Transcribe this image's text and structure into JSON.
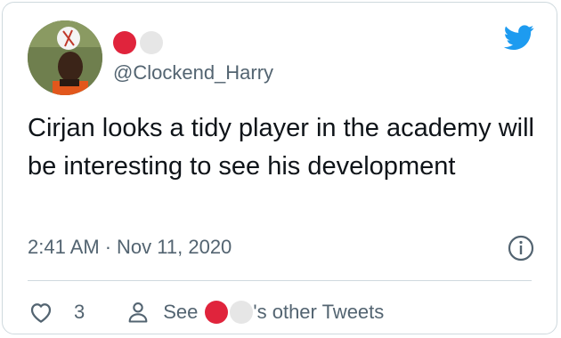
{
  "user": {
    "handle": "@Clockend_Harry"
  },
  "tweet": {
    "text": "Cirjan looks a tidy player in the academy will be interesting to see his development",
    "time": "2:41 AM",
    "separator": "·",
    "date": "Nov 11, 2020"
  },
  "actions": {
    "like_count": "3",
    "see_label": "See",
    "other_tweets_label": "'s other Tweets"
  },
  "colors": {
    "brand": "#1d9bf0",
    "secondary_text": "#536471",
    "primary_text": "#0f1419",
    "border": "#cfd9de",
    "name_dot_red": "#e0243c",
    "name_dot_grey": "#e6e6e6"
  },
  "icons": {
    "logo": "twitter-bird-icon",
    "info": "info-icon",
    "like": "heart-icon",
    "profile": "person-icon"
  }
}
